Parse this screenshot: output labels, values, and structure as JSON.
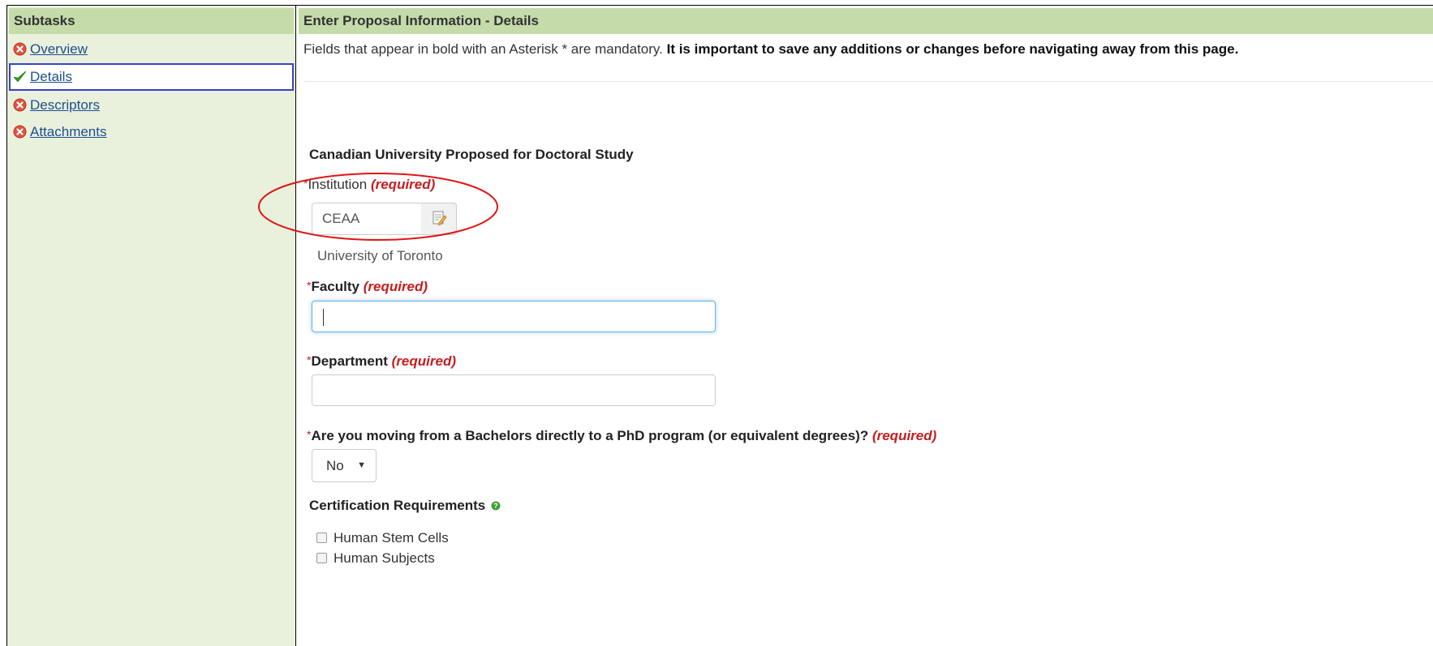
{
  "sidebar": {
    "header": "Subtasks",
    "items": [
      {
        "label": "Overview",
        "status": "incomplete",
        "icon": "error-circle-icon"
      },
      {
        "label": "Details",
        "status": "complete",
        "icon": "checkmark-icon"
      },
      {
        "label": "Descriptors",
        "status": "incomplete",
        "icon": "error-circle-icon"
      },
      {
        "label": "Attachments",
        "status": "incomplete",
        "icon": "error-circle-icon"
      }
    ]
  },
  "main": {
    "header": "Enter Proposal Information - Details",
    "intro_normal": "Fields that appear in bold with an Asterisk * are mandatory. ",
    "intro_bold": "It is important to save any additions or changes before navigating away from this page."
  },
  "form": {
    "section_title": "Canadian University Proposed for Doctoral Study",
    "required_text": "(required)",
    "required_star": "*",
    "institution": {
      "label": "Institution",
      "code_value": "CEAA",
      "name": "University of Toronto",
      "lookup_icon": "edit-lookup-icon"
    },
    "faculty": {
      "label": "Faculty",
      "value": ""
    },
    "department": {
      "label": "Department",
      "value": ""
    },
    "bachelors_phd": {
      "label": "Are you moving from a Bachelors directly to a PhD program (or equivalent degrees)?",
      "selected": "No",
      "caret": "▼"
    },
    "certification": {
      "title": "Certification Requirements",
      "help_icon": "help-icon",
      "options": [
        {
          "label": "Human Stem Cells",
          "checked": false
        },
        {
          "label": "Human Subjects",
          "checked": false
        }
      ]
    }
  },
  "colors": {
    "header_bg": "#c5dbaa",
    "sidebar_bg": "#e9f1dd",
    "required_red": "#c41e1e",
    "link_blue": "#1f4e8f",
    "annotation_red": "#e11414"
  }
}
